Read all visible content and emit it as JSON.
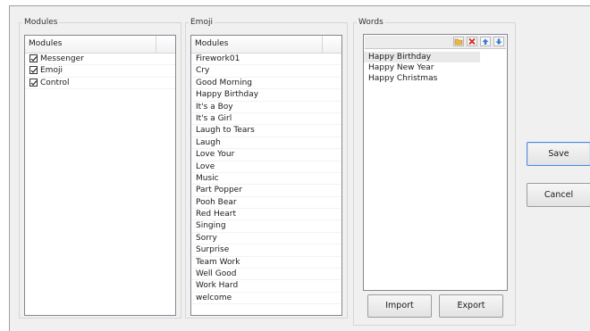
{
  "modules_panel": {
    "title": "Modules",
    "header": "Modules",
    "items": [
      {
        "label": "Messenger",
        "checked": true
      },
      {
        "label": "Emoji",
        "checked": true
      },
      {
        "label": "Control",
        "checked": true
      }
    ]
  },
  "emoji_panel": {
    "title": "Emoji",
    "header": "Modules",
    "items": [
      "Firework01",
      "Cry",
      "Good Morning",
      "Happy Birthday",
      "It's a Boy",
      "It's a Girl",
      "Laugh to Tears",
      "Laugh",
      "Love Your",
      "Love",
      "Music",
      "Part Popper",
      "Pooh Bear",
      "Red Heart",
      "Singing",
      "Sorry",
      "Surprise",
      "Team Work",
      "Well Good",
      "Work Hard",
      "welcome"
    ]
  },
  "words_panel": {
    "title": "Words",
    "toolbar_icons": [
      "open-folder-icon",
      "delete-icon",
      "move-up-icon",
      "move-down-icon"
    ],
    "items": [
      "Happy Birthday",
      "Happy New Year",
      "Happy Christmas"
    ],
    "selected_index": 0,
    "import_label": "Import",
    "export_label": "Export"
  },
  "actions": {
    "save_label": "Save",
    "cancel_label": "Cancel"
  },
  "colors": {
    "accent_border": "#4a8cd6",
    "delete_red": "#d62020",
    "arrow_blue": "#3a78d8",
    "folder_yellow": "#e8b84a"
  }
}
